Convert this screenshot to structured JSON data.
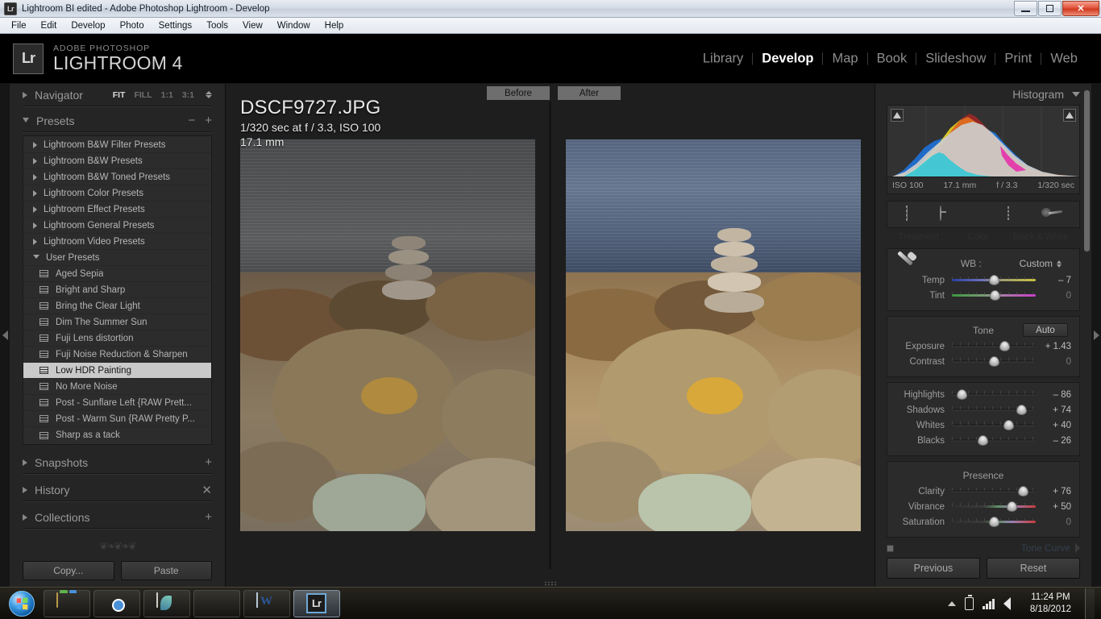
{
  "window": {
    "title": "Lightroom BI edited - Adobe Photoshop Lightroom - Develop",
    "app_icon": "Lr",
    "minimize_label": "minimize",
    "restore_label": "restore",
    "close_label": "✕"
  },
  "menubar": {
    "items": [
      "File",
      "Edit",
      "Develop",
      "Photo",
      "Settings",
      "Tools",
      "View",
      "Window",
      "Help"
    ]
  },
  "identity": {
    "badge": "Lr",
    "line1": "ADOBE PHOTOSHOP",
    "line2": "LIGHTROOM 4"
  },
  "modules": {
    "items": [
      "Library",
      "Develop",
      "Map",
      "Book",
      "Slideshow",
      "Print",
      "Web"
    ],
    "active": "Develop"
  },
  "left_panel": {
    "navigator": {
      "title": "Navigator",
      "zoom_levels": [
        "FIT",
        "FILL",
        "1:1",
        "3:1"
      ],
      "active_zoom": "FIT"
    },
    "presets": {
      "title": "Presets",
      "minus": "−",
      "plus": "+",
      "groups": [
        "Lightroom B&W Filter Presets",
        "Lightroom B&W Presets",
        "Lightroom B&W Toned Presets",
        "Lightroom Color Presets",
        "Lightroom Effect Presets",
        "Lightroom General Presets",
        "Lightroom Video Presets"
      ],
      "user_group": "User Presets",
      "user_presets": [
        "Aged Sepia",
        "Bright and Sharp",
        "Bring the Clear Light",
        "Dim The Summer Sun",
        "Fuji Lens distortion",
        "Fuji Noise Reduction & Sharpen",
        "Low HDR Painting",
        "No More Noise",
        "Post - Sunflare Left {RAW Prett...",
        "Post - Warm Sun {RAW Pretty P...",
        "Sharp as a tack"
      ],
      "selected": "Low HDR Painting"
    },
    "snapshots": {
      "title": "Snapshots",
      "action": "+"
    },
    "history": {
      "title": "History",
      "action": "✕"
    },
    "collections": {
      "title": "Collections",
      "action": "+"
    },
    "buttons": {
      "copy": "Copy...",
      "paste": "Paste"
    }
  },
  "center": {
    "before_label": "Before",
    "after_label": "After",
    "photo_info": {
      "filename": "DSCF9727.JPG",
      "exposure_line": "1/320 sec at f / 3.3, ISO 100",
      "focal_line": "17.1 mm"
    }
  },
  "right_panel": {
    "histogram": {
      "title": "Histogram",
      "iso": "ISO 100",
      "focal": "17.1 mm",
      "aperture": "f / 3.3",
      "shutter": "1/320 sec"
    },
    "tools": [
      "crop-overlay",
      "spot-removal",
      "red-eye-correction",
      "graduated-filter",
      "adjustment-brush"
    ],
    "treatment": {
      "label": "Treatment :",
      "color": "Color",
      "bw": "Black & White"
    },
    "basic": {
      "wb_label": "WB :",
      "wb_value": "Custom",
      "sliders_wb": [
        {
          "name": "Temp",
          "value": "– 7",
          "pos": 50,
          "type": "temp"
        },
        {
          "name": "Tint",
          "value": "0",
          "pos": 51,
          "type": "tint"
        }
      ],
      "tone_title": "Tone",
      "auto_label": "Auto",
      "sliders_tone": [
        {
          "name": "Exposure",
          "value": "+ 1.43",
          "pos": 63,
          "type": "plain"
        },
        {
          "name": "Contrast",
          "value": "0",
          "pos": 50,
          "type": "plain"
        }
      ],
      "sliders_tone2": [
        {
          "name": "Highlights",
          "value": "– 86",
          "pos": 12,
          "type": "plain"
        },
        {
          "name": "Shadows",
          "value": "+ 74",
          "pos": 83,
          "type": "plain"
        },
        {
          "name": "Whites",
          "value": "+ 40",
          "pos": 68,
          "type": "plain"
        },
        {
          "name": "Blacks",
          "value": "– 26",
          "pos": 37,
          "type": "plain"
        }
      ],
      "presence_title": "Presence",
      "sliders_presence": [
        {
          "name": "Clarity",
          "value": "+ 76",
          "pos": 85,
          "type": "plain"
        },
        {
          "name": "Vibrance",
          "value": "+ 50",
          "pos": 72,
          "type": "sat"
        },
        {
          "name": "Saturation",
          "value": "0",
          "pos": 50,
          "type": "sat"
        }
      ]
    },
    "tone_curve_label": "Tone Curve",
    "buttons": {
      "previous": "Previous",
      "reset": "Reset"
    }
  },
  "taskbar": {
    "start_label": "Start",
    "apps": [
      "file-explorer",
      "google-chrome",
      "feather-app",
      "sphere-app",
      "microsoft-word",
      "lightroom"
    ],
    "active_app": "lightroom",
    "clock_time": "11:24 PM",
    "clock_date": "8/18/2012"
  }
}
